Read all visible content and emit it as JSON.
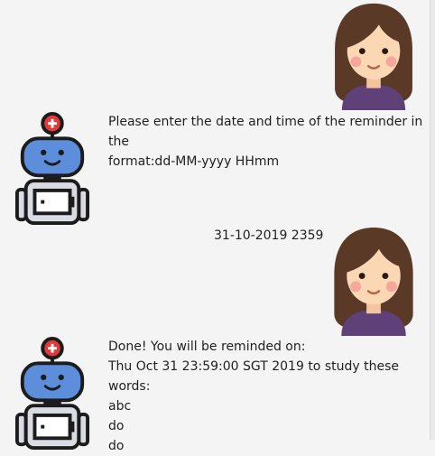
{
  "chat": {
    "messages": [
      {
        "sender": "user",
        "avatar": "user-girl-icon"
      },
      {
        "sender": "bot",
        "avatar": "robot-icon",
        "lines": [
          "Please enter the date and time of the reminder in the",
          "format:dd-MM-yyyy HHmm"
        ]
      },
      {
        "sender": "user",
        "avatar": "user-girl-icon",
        "lines": [
          "31-10-2019 2359"
        ]
      },
      {
        "sender": "bot",
        "avatar": "robot-icon",
        "lines": [
          "Done! You will be reminded on:",
          "Thu Oct 31 23:59:00 SGT 2019 to study these words:",
          "abc",
          "do",
          "do"
        ]
      }
    ]
  },
  "colors": {
    "background": "#f4f4f4",
    "hair": "#5a3a26",
    "skin": "#fbd7b3",
    "cheek": "#f49a97",
    "shirt": "#5f4079",
    "robot_head": "#5d8edb",
    "robot_outline": "#1c1c1c",
    "robot_light": "#e23a3a",
    "robot_body": "#d9dde3"
  }
}
